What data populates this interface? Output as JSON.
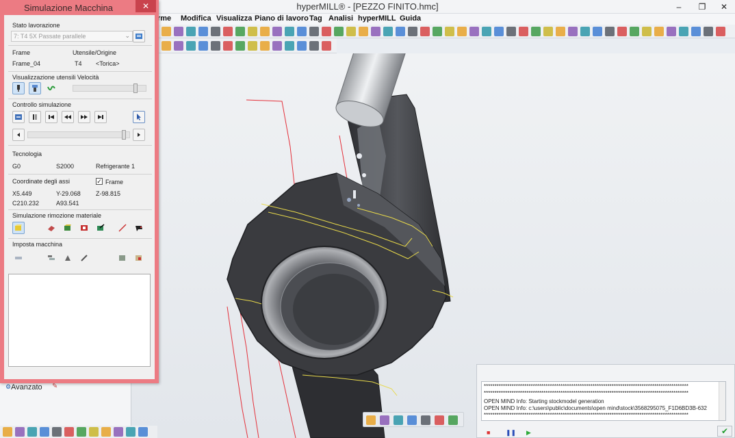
{
  "window": {
    "title": "hyperMILL® - [PEZZO FINITO.hmc]",
    "minimize_icon": "minimize-icon",
    "maximize_icon": "maximize-icon",
    "close_icon": "close-icon"
  },
  "menubar": {
    "items": [
      "rme",
      "Modifica",
      "Visualizza",
      "Piano di lavoro",
      "Tag",
      "Analisi",
      "hyperMILL",
      "Guida"
    ]
  },
  "dialog": {
    "title": "Simulazione Macchina",
    "close_label": "✕",
    "stato": {
      "label": "Stato lavorazione",
      "value": "7: T4 5X Passate parallele"
    },
    "frame": {
      "frame_label": "Frame",
      "frame_value": "Frame_04",
      "tool_label": "Utensile/Origine",
      "tool_value": "T4",
      "tool_origin": "<Torica>"
    },
    "visualizzazione_label": "Visualizzazione utensili Velocità",
    "velocita_level": 0.9,
    "controllo_label": "Controllo simulazione",
    "progress_level": 0.98,
    "tecnologia": {
      "label": "Tecnologia",
      "g": "G0",
      "s": "S2000",
      "coolant": "Refrigerante 1"
    },
    "coordinate": {
      "label": "Coordinate degli assi",
      "frame_checkbox_label": "Frame",
      "frame_checked": true,
      "x": "X5.449",
      "y": "Y-29.068",
      "z": "Z-98.815",
      "c": "C210.232",
      "a": "A93.541"
    },
    "rimozione_label": "Simulazione rimozione materiale",
    "imposta_label": "Imposta macchina"
  },
  "browser": {
    "avanzato_label": "Avanzato"
  },
  "log": {
    "lines": [
      "************************************************************************************************",
      "************************************************************************************************",
      "OPEN MIND Info:    Starting stockmodel generation",
      "OPEN MIND Info:    c:\\users\\public\\documents\\open mind\\stock\\3568295075_F1D6BD3B-632",
      "************************************************************************************************"
    ]
  },
  "ok_label": "✔",
  "colors": {
    "dialog_border": "#ec7b83",
    "close_button": "#c9434d",
    "toolpath_red": "#e4303a",
    "toolpath_yellow": "#e8d94a",
    "part": "#3a3b3f"
  }
}
